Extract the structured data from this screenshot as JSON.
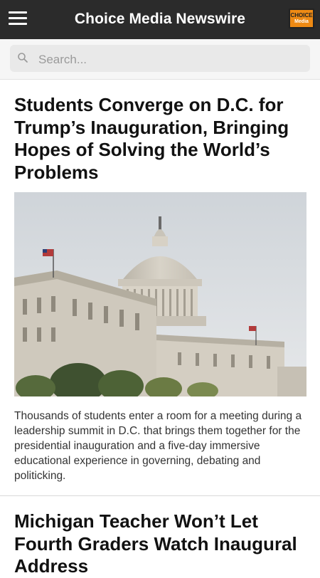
{
  "header": {
    "menu_icon": "hamburger-menu-icon",
    "title": "Choice Media Newswire",
    "logo_line1": "CHOICE",
    "logo_line2": "Media"
  },
  "search": {
    "placeholder": "Search...",
    "value": "",
    "icon": "search-icon"
  },
  "articles": [
    {
      "headline": "Students Converge on D.C. for Trump’s Inauguration, Bringing Hopes of Solving the World’s Problems",
      "image": "us-capitol-building-photo",
      "summary": "Thousands of students enter a room for a meeting during a leadership summit in D.C. that brings them together for the presidential inauguration and a five-day immersive educational experience in governing, debating and politicking."
    },
    {
      "headline": "Michigan Teacher Won’t Let Fourth Graders Watch Inaugural Address"
    }
  ],
  "colors": {
    "topbar": "#2b2b2b",
    "logo_bg": "#ee8a14",
    "search_bg": "#e9e9e9",
    "page_bg": "#ffffff"
  }
}
